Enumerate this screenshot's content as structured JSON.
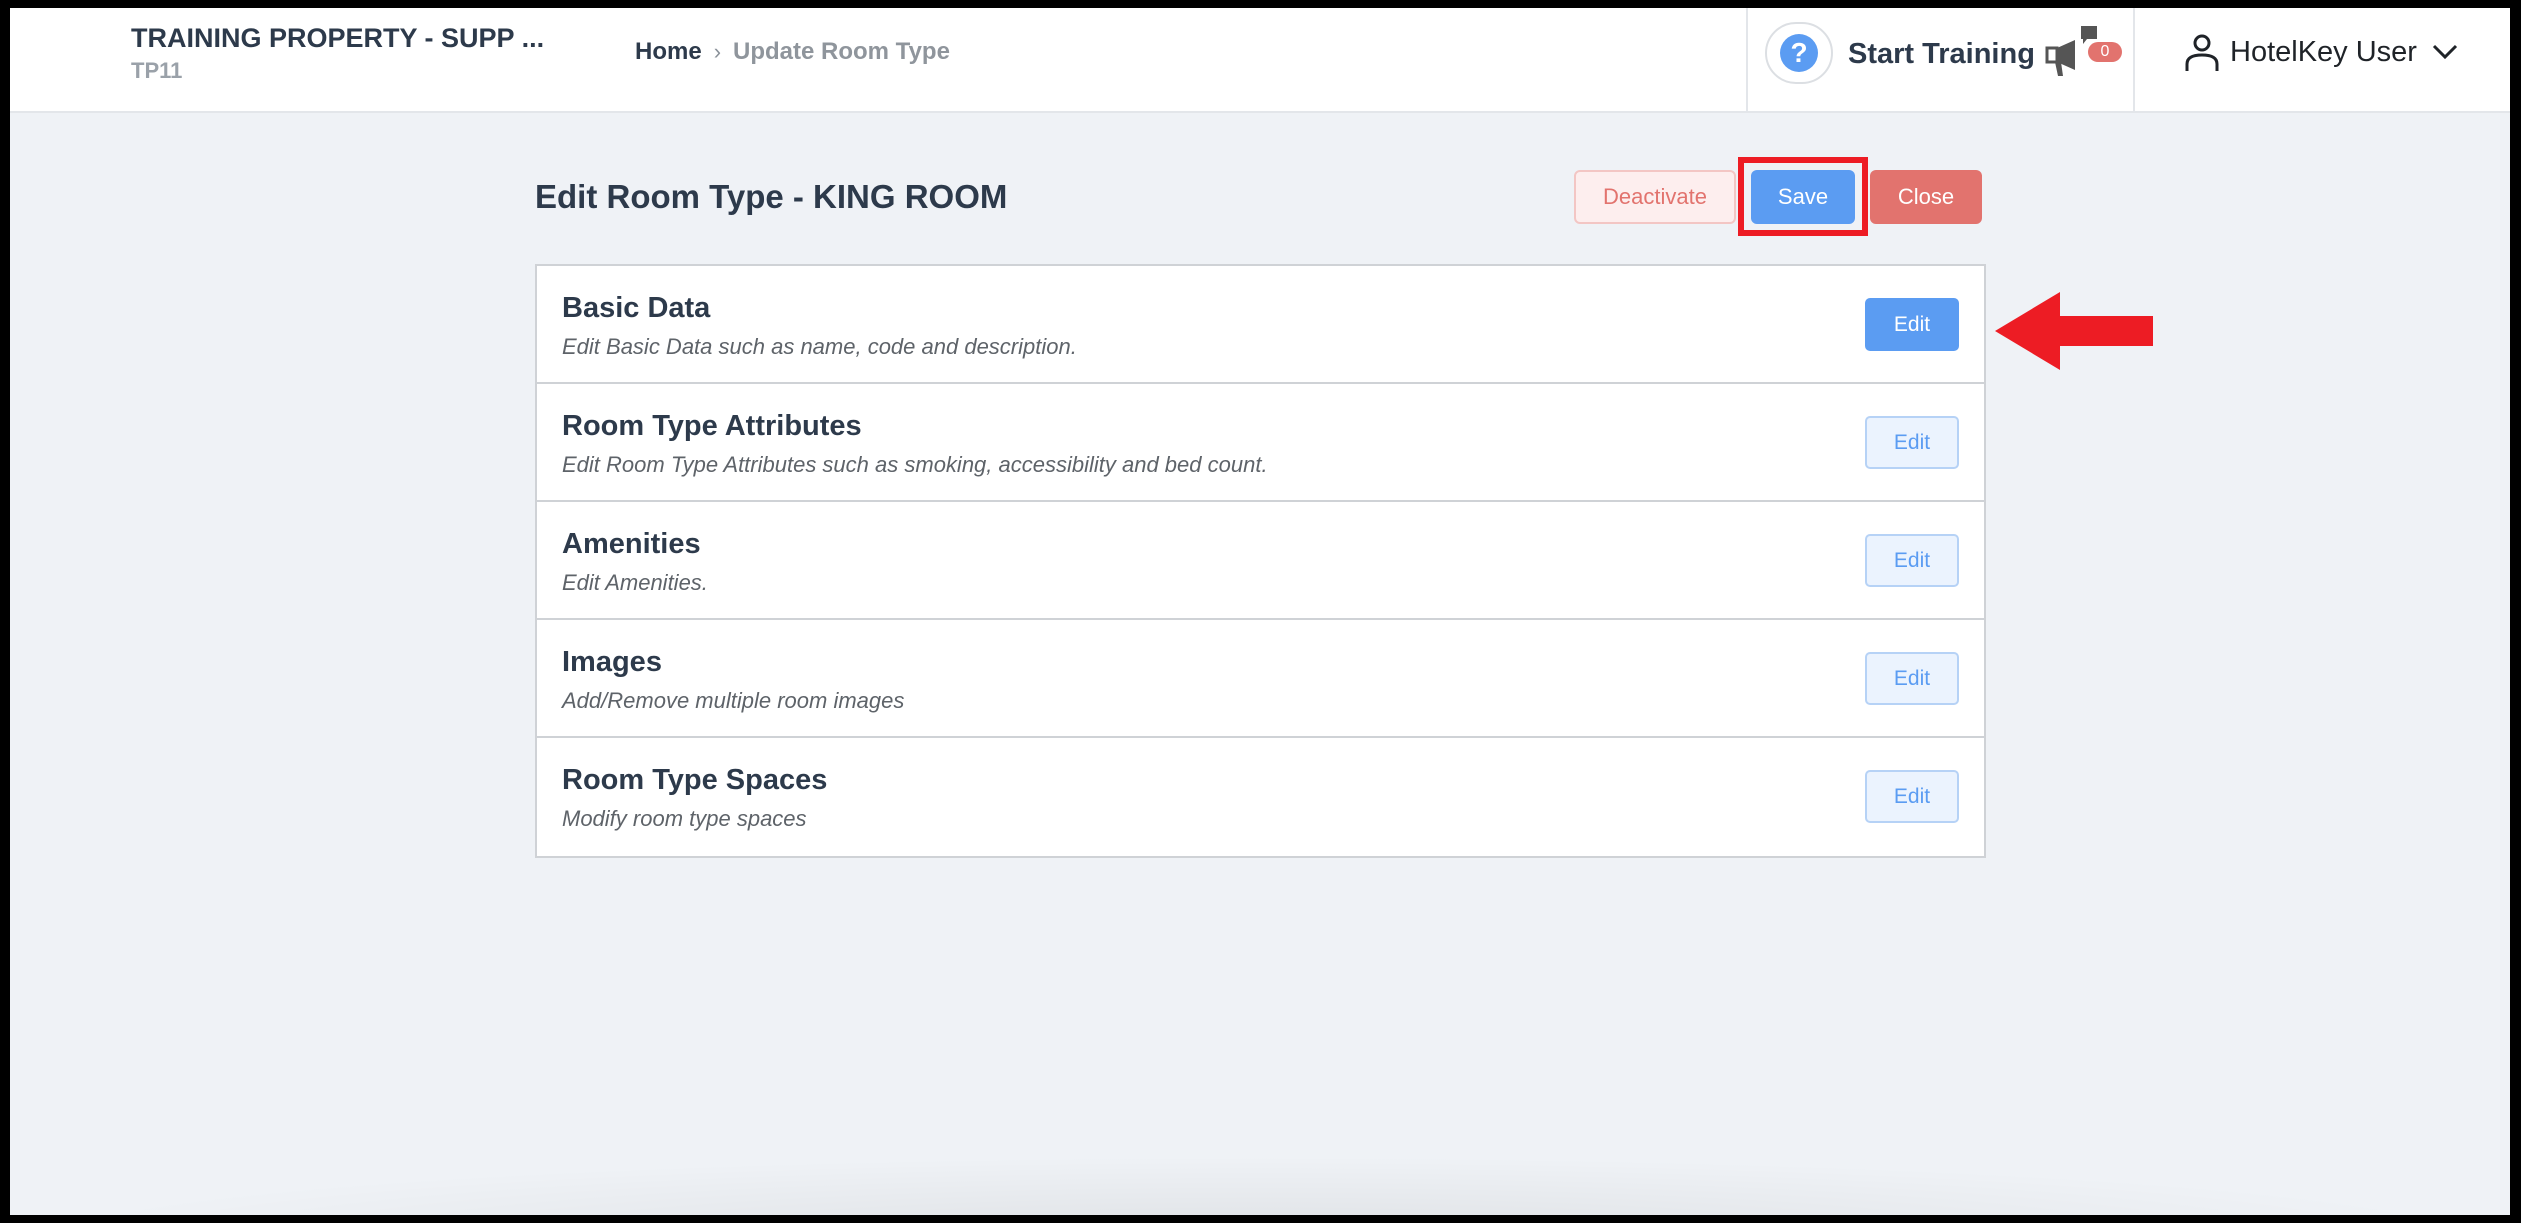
{
  "header": {
    "property_name": "TRAINING PROPERTY - SUPP ...",
    "property_code": "TP11",
    "breadcrumb": {
      "home": "Home",
      "separator": "›",
      "current": "Update Room Type"
    },
    "help_icon": "question-circle-icon",
    "help_glyph": "?",
    "start_training": "Start Training",
    "announcement_icon": "megaphone-icon",
    "notification_count": "0",
    "user_icon": "user-icon",
    "user_name": "HotelKey User",
    "user_menu_icon": "chevron-down-icon"
  },
  "page": {
    "title": "Edit Room Type - KING ROOM",
    "actions": {
      "deactivate": "Deactivate",
      "save": "Save",
      "close": "Close"
    }
  },
  "sections": [
    {
      "title": "Basic Data",
      "description": "Edit Basic Data such as name, code and description.",
      "edit_label": "Edit",
      "primary": true
    },
    {
      "title": "Room Type Attributes",
      "description": "Edit Room Type Attributes such as smoking, accessibility and bed count.",
      "edit_label": "Edit",
      "primary": false
    },
    {
      "title": "Amenities",
      "description": "Edit Amenities.",
      "edit_label": "Edit",
      "primary": false
    },
    {
      "title": "Images",
      "description": "Add/Remove multiple room images",
      "edit_label": "Edit",
      "primary": false
    },
    {
      "title": "Room Type Spaces",
      "description": "Modify room type spaces",
      "edit_label": "Edit",
      "primary": false
    }
  ],
  "annotations": {
    "highlight_target": "Save",
    "arrow_target": "Basic Data Edit",
    "highlight_color": "#ed1c24"
  },
  "colors": {
    "primary_blue": "#5b9cf2",
    "danger_red": "#e2736e",
    "text_dark": "#2d3a4b",
    "background": "#eff2f6"
  }
}
